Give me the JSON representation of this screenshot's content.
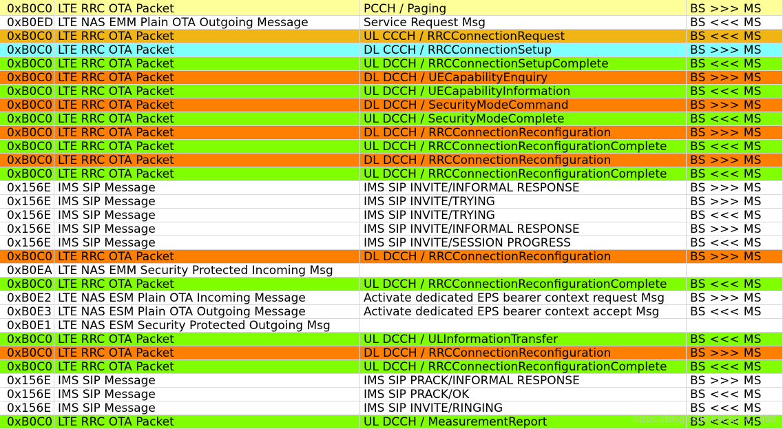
{
  "colors": {
    "pale_yellow": "#ffff99",
    "white": "#ffffff",
    "amber": "#f0b414",
    "cyan": "#80ffff",
    "green": "#80ff00",
    "orange": "#ff8000"
  },
  "watermark": "https://blog.csdn.net/qq_4...898",
  "rows": [
    {
      "code": "0xB0C0",
      "name": "LTE RRC OTA Packet",
      "msg": "PCCH / Paging",
      "dir": "BS >>> MS",
      "bg": "#ffff99"
    },
    {
      "code": "0xB0ED",
      "name": "LTE NAS EMM Plain OTA Outgoing Message",
      "msg": "Service Request Msg",
      "dir": "BS <<< MS",
      "bg": "#ffffff"
    },
    {
      "code": "0xB0C0",
      "name": "LTE RRC OTA Packet",
      "msg": "UL  CCCH / RRCConnectionRequest",
      "dir": "BS <<< MS",
      "bg": "#f0b414"
    },
    {
      "code": "0xB0C0",
      "name": "LTE RRC OTA Packet",
      "msg": "DL  CCCH / RRCConnectionSetup",
      "dir": "BS >>> MS",
      "bg": "#80ffff"
    },
    {
      "code": "0xB0C0",
      "name": "LTE RRC OTA Packet",
      "msg": "UL  DCCH / RRCConnectionSetupComplete",
      "dir": "BS <<< MS",
      "bg": "#80ff00"
    },
    {
      "code": "0xB0C0",
      "name": "LTE RRC OTA Packet",
      "msg": "DL  DCCH / UECapabilityEnquiry",
      "dir": "BS >>> MS",
      "bg": "#ff8000"
    },
    {
      "code": "0xB0C0",
      "name": "LTE RRC OTA Packet",
      "msg": "UL  DCCH / UECapabilityInformation",
      "dir": "BS <<< MS",
      "bg": "#80ff00"
    },
    {
      "code": "0xB0C0",
      "name": "LTE RRC OTA Packet",
      "msg": "DL  DCCH / SecurityModeCommand",
      "dir": "BS >>> MS",
      "bg": "#ff8000"
    },
    {
      "code": "0xB0C0",
      "name": "LTE RRC OTA Packet",
      "msg": "UL  DCCH / SecurityModeComplete",
      "dir": "BS <<< MS",
      "bg": "#80ff00"
    },
    {
      "code": "0xB0C0",
      "name": "LTE RRC OTA Packet",
      "msg": "DL  DCCH / RRCConnectionReconfiguration",
      "dir": "BS >>> MS",
      "bg": "#ff8000"
    },
    {
      "code": "0xB0C0",
      "name": "LTE RRC OTA Packet",
      "msg": "UL  DCCH / RRCConnectionReconfigurationComplete",
      "dir": "BS <<< MS",
      "bg": "#80ff00"
    },
    {
      "code": "0xB0C0",
      "name": "LTE RRC OTA Packet",
      "msg": "DL  DCCH / RRCConnectionReconfiguration",
      "dir": "BS >>> MS",
      "bg": "#ff8000"
    },
    {
      "code": "0xB0C0",
      "name": "LTE RRC OTA Packet",
      "msg": "UL  DCCH / RRCConnectionReconfigurationComplete",
      "dir": "BS <<< MS",
      "bg": "#80ff00"
    },
    {
      "code": "0x156E",
      "name": "IMS SIP Message",
      "msg": "IMS  SIP  INVITE/INFORMAL  RESPONSE",
      "dir": "BS >>> MS",
      "bg": "#ffffff"
    },
    {
      "code": "0x156E",
      "name": "IMS SIP Message",
      "msg": "IMS  SIP  INVITE/TRYING",
      "dir": "BS >>> MS",
      "bg": "#ffffff"
    },
    {
      "code": "0x156E",
      "name": "IMS SIP Message",
      "msg": "IMS  SIP  INVITE/TRYING",
      "dir": "BS <<< MS",
      "bg": "#ffffff"
    },
    {
      "code": "0x156E",
      "name": "IMS SIP Message",
      "msg": "IMS  SIP  INVITE/INFORMAL  RESPONSE",
      "dir": "BS >>> MS",
      "bg": "#ffffff"
    },
    {
      "code": "0x156E",
      "name": "IMS SIP Message",
      "msg": "IMS  SIP  INVITE/SESSION  PROGRESS",
      "dir": "BS <<< MS",
      "bg": "#ffffff"
    },
    {
      "code": "0xB0C0",
      "name": "LTE RRC OTA Packet",
      "msg": "DL  DCCH / RRCConnectionReconfiguration",
      "dir": "BS >>> MS",
      "bg": "#ff8000"
    },
    {
      "code": "0xB0EA",
      "name": "LTE NAS EMM Security Protected Incoming Msg",
      "msg": "",
      "dir": "",
      "bg": "#ffffff"
    },
    {
      "code": "0xB0C0",
      "name": "LTE RRC OTA Packet",
      "msg": "UL  DCCH / RRCConnectionReconfigurationComplete",
      "dir": "BS <<< MS",
      "bg": "#80ff00"
    },
    {
      "code": "0xB0E2",
      "name": "LTE NAS ESM Plain OTA Incoming Message",
      "msg": "Activate dedicated EPS bearer context request Msg",
      "dir": "BS >>> MS",
      "bg": "#ffffff"
    },
    {
      "code": "0xB0E3",
      "name": "LTE NAS ESM Plain OTA Outgoing Message",
      "msg": "Activate dedicated EPS bearer context accept Msg",
      "dir": "BS <<< MS",
      "bg": "#ffffff"
    },
    {
      "code": "0xB0E1",
      "name": "LTE NAS ESM Security Protected Outgoing Msg",
      "msg": "",
      "dir": "",
      "bg": "#ffffff"
    },
    {
      "code": "0xB0C0",
      "name": "LTE RRC OTA Packet",
      "msg": "UL  DCCH / ULInformationTransfer",
      "dir": "BS <<< MS",
      "bg": "#80ff00"
    },
    {
      "code": "0xB0C0",
      "name": "LTE RRC OTA Packet",
      "msg": "DL  DCCH / RRCConnectionReconfiguration",
      "dir": "BS >>> MS",
      "bg": "#ff8000"
    },
    {
      "code": "0xB0C0",
      "name": "LTE RRC OTA Packet",
      "msg": "UL  DCCH / RRCConnectionReconfigurationComplete",
      "dir": "BS <<< MS",
      "bg": "#80ff00"
    },
    {
      "code": "0x156E",
      "name": "IMS SIP Message",
      "msg": "IMS  SIP  PRACK/INFORMAL  RESPONSE",
      "dir": "BS >>> MS",
      "bg": "#ffffff"
    },
    {
      "code": "0x156E",
      "name": "IMS SIP Message",
      "msg": "IMS  SIP  PRACK/OK",
      "dir": "BS <<< MS",
      "bg": "#ffffff"
    },
    {
      "code": "0x156E",
      "name": "IMS SIP Message",
      "msg": "IMS  SIP  INVITE/RINGING",
      "dir": "BS <<< MS",
      "bg": "#ffffff"
    },
    {
      "code": "0xB0C0",
      "name": "LTE RRC OTA Packet",
      "msg": "UL  DCCH / MeasurementReport",
      "dir": "BS <<< MS",
      "bg": "#80ff00"
    }
  ]
}
